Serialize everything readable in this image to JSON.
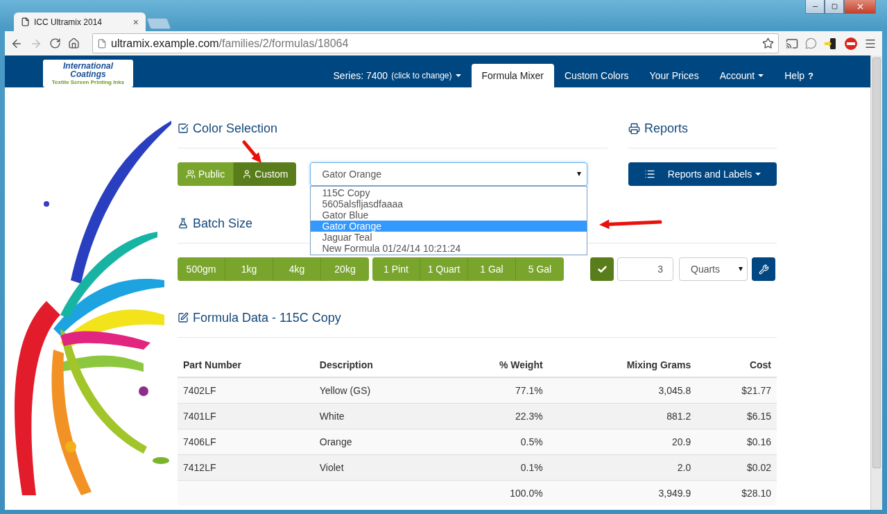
{
  "browser": {
    "tab_title": "ICC Ultramix 2014",
    "tab_close": "×",
    "url_host": "ultramix.example.com",
    "url_path": "/families/2/formulas/18064"
  },
  "logo": {
    "line_1": "International",
    "line_2": "Coatings",
    "tagline": "Textile Screen Printing Inks"
  },
  "series": {
    "label": "Series: 7400",
    "hint": "(click to change)"
  },
  "nav": [
    {
      "label": "Formula Mixer",
      "selected": true,
      "kind": "link"
    },
    {
      "label": "Custom Colors",
      "selected": false,
      "kind": "link"
    },
    {
      "label": "Your Prices",
      "selected": false,
      "kind": "link"
    },
    {
      "label": "Account",
      "selected": false,
      "kind": "menu"
    },
    {
      "label": "Help",
      "selected": false,
      "kind": "help",
      "mark": "?"
    }
  ],
  "color_selection": {
    "title": "Color Selection",
    "sources": [
      {
        "label": "Public",
        "selected": false,
        "kind": "group"
      },
      {
        "label": "Custom",
        "selected": true,
        "kind": "user"
      }
    ],
    "formula": {
      "value": "Gator Orange",
      "options": [
        {
          "label": "115C Copy",
          "selected": false
        },
        {
          "label": "5605alsfljasdfaaaa",
          "selected": false
        },
        {
          "label": "Gator Blue",
          "selected": false
        },
        {
          "label": "Gator Orange",
          "selected": true
        },
        {
          "label": "Jaguar Teal",
          "selected": false
        },
        {
          "label": "New Formula 01/24/14 10:21:24",
          "selected": false
        }
      ]
    }
  },
  "reports": {
    "title": "Reports",
    "button": "Reports and Labels"
  },
  "batch": {
    "title": "Batch Size",
    "metric": [
      "500gm",
      "1kg",
      "4kg",
      "20kg"
    ],
    "imperial": [
      "1 Pint",
      "1 Quart",
      "1 Gal",
      "5 Gal"
    ],
    "quantity": "3",
    "unit": "Quarts"
  },
  "formula_data": {
    "title": "Formula Data - 115C Copy",
    "columns": [
      "Part Number",
      "Description",
      "% Weight",
      "Mixing Grams",
      "Cost"
    ],
    "rows": [
      [
        "7402LF",
        "Yellow (GS)",
        "77.1%",
        "3,045.8",
        "$21.77"
      ],
      [
        "7401LF",
        "White",
        "22.3%",
        "881.2",
        "$6.15"
      ],
      [
        "7406LF",
        "Orange",
        "0.5%",
        "20.9",
        "$0.16"
      ],
      [
        "7412LF",
        "Violet",
        "0.1%",
        "2.0",
        "$0.02"
      ]
    ],
    "total": [
      "100.0%",
      "3,949.9",
      "$28.10"
    ]
  }
}
